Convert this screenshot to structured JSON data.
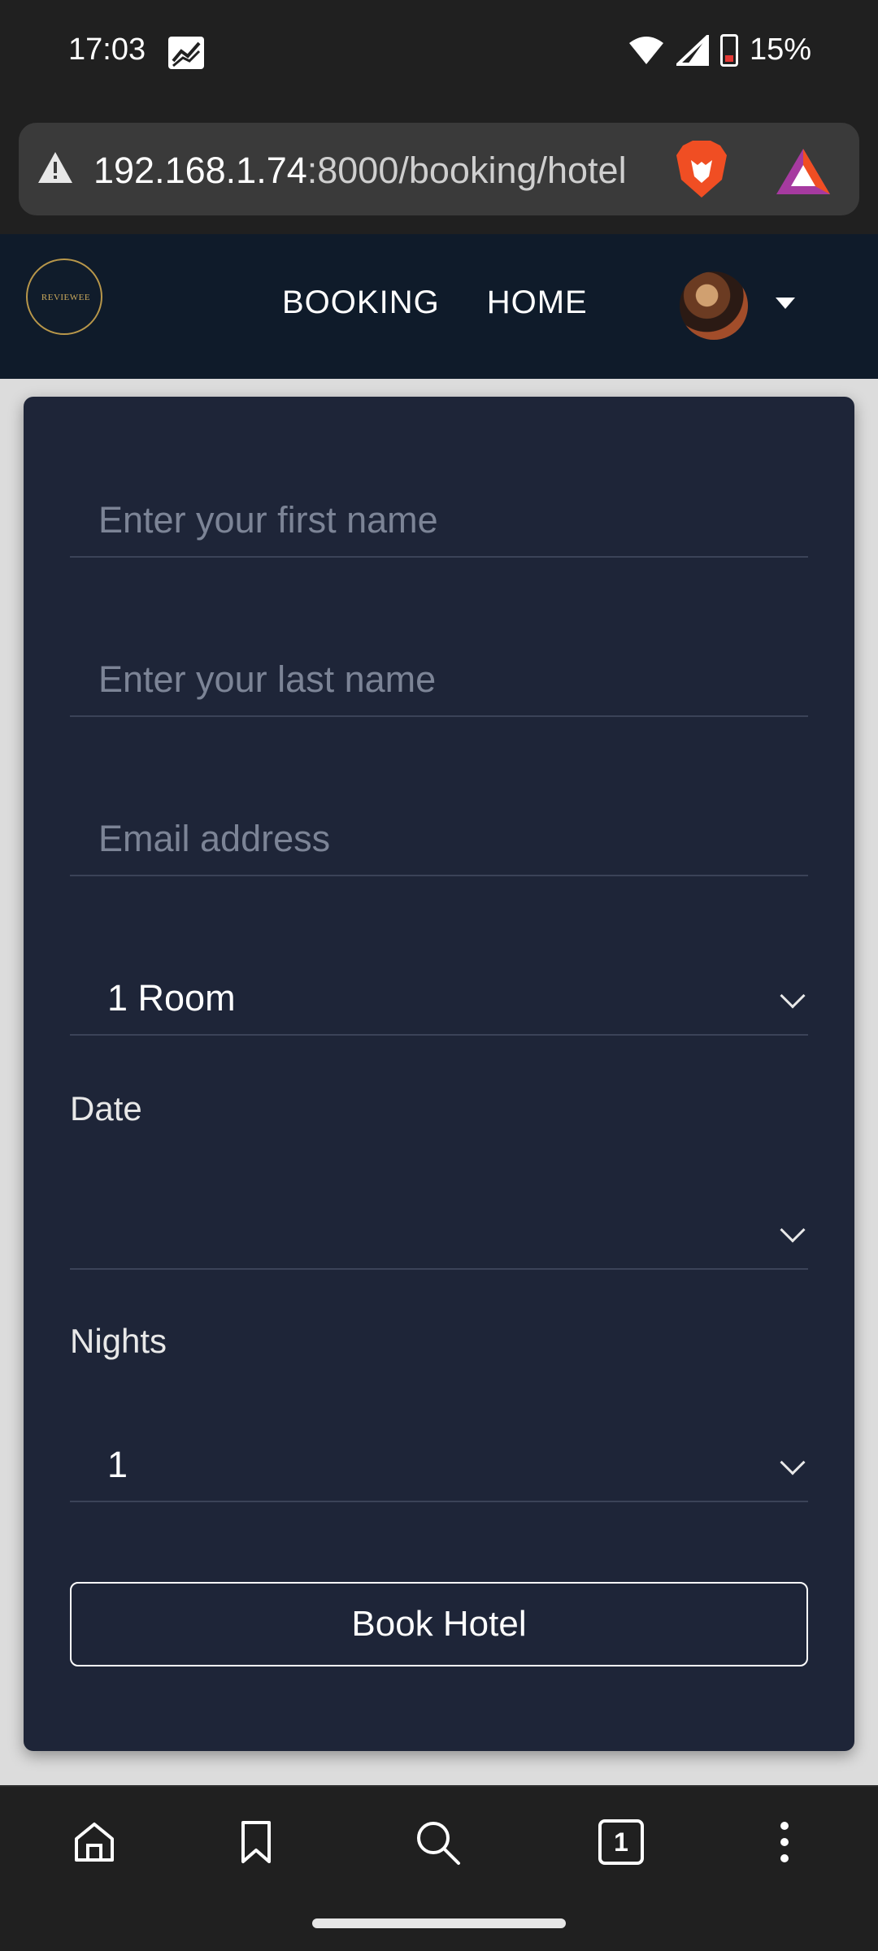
{
  "status_bar": {
    "time": "17:03",
    "battery": "15%"
  },
  "browser": {
    "url_host": "192.168.1.74",
    "url_path": ":8000/booking/hotel"
  },
  "site_nav": {
    "logo_text": "REVIEWEE",
    "links": [
      "BOOKING",
      "HOME"
    ]
  },
  "form": {
    "first_name_placeholder": "Enter your first name",
    "last_name_placeholder": "Enter your last name",
    "email_placeholder": "Email address",
    "rooms_value": "1 Room",
    "date_label": "Date",
    "date_value": "",
    "nights_label": "Nights",
    "nights_value": "1",
    "submit_label": "Book Hotel"
  },
  "bottom_toolbar": {
    "tab_count": "1"
  },
  "colors": {
    "nav_bg": "#0f1b2a",
    "card_bg": "#1e2538",
    "page_bg": "#dcdcdc"
  }
}
